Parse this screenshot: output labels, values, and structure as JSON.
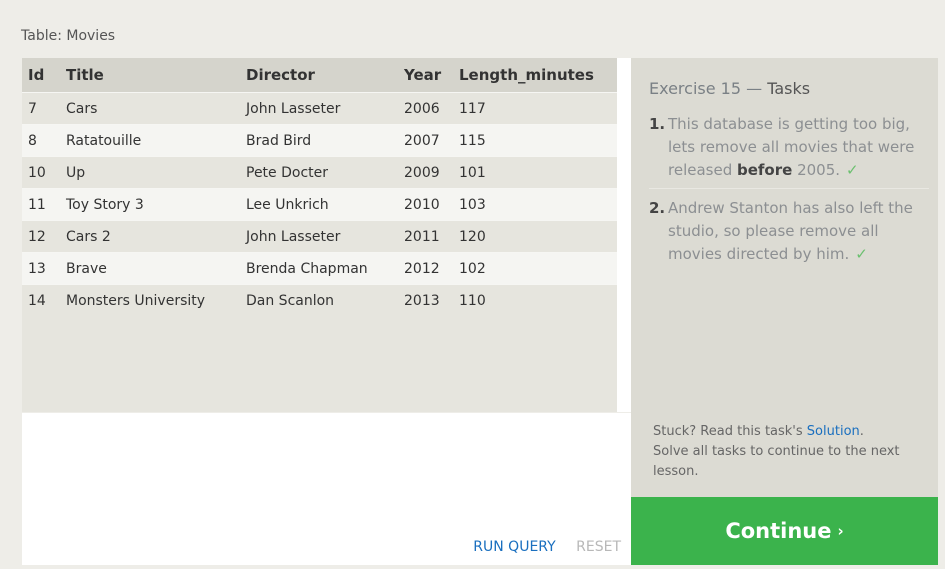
{
  "table_caption": "Table: Movies",
  "columns": [
    "Id",
    "Title",
    "Director",
    "Year",
    "Length_minutes"
  ],
  "rows": [
    [
      "7",
      "Cars",
      "John Lasseter",
      "2006",
      "117"
    ],
    [
      "8",
      "Ratatouille",
      "Brad Bird",
      "2007",
      "115"
    ],
    [
      "10",
      "Up",
      "Pete Docter",
      "2009",
      "101"
    ],
    [
      "11",
      "Toy Story 3",
      "Lee Unkrich",
      "2010",
      "103"
    ],
    [
      "12",
      "Cars 2",
      "John Lasseter",
      "2011",
      "120"
    ],
    [
      "13",
      "Brave",
      "Brenda Chapman",
      "2012",
      "102"
    ],
    [
      "14",
      "Monsters University",
      "Dan Scanlon",
      "2013",
      "110"
    ]
  ],
  "editor": {
    "run_label": "RUN QUERY",
    "reset_label": "RESET"
  },
  "tasks": {
    "title_prefix": "Exercise 15 — ",
    "title_main": "Tasks",
    "items": [
      {
        "num": "1.",
        "text_before": "This database is getting too big, lets remove all movies that were released ",
        "bold": "before",
        "text_after": " 2005.",
        "check": "✓"
      },
      {
        "num": "2.",
        "text_before": "Andrew Stanton has also left the studio, so please remove all movies directed by him.",
        "bold": "",
        "text_after": "",
        "check": "✓"
      }
    ],
    "stuck_prefix": "Stuck? Read this task's ",
    "solution_link": "Solution",
    "stuck_suffix": ".",
    "solve_note": "Solve all tasks to continue to the next lesson."
  },
  "continue": {
    "label": "Continue",
    "chevron": "›"
  },
  "colors": {
    "accent_blue": "#1a6fbf",
    "continue_green": "#3bb34c",
    "check_green": "#6cc070"
  }
}
